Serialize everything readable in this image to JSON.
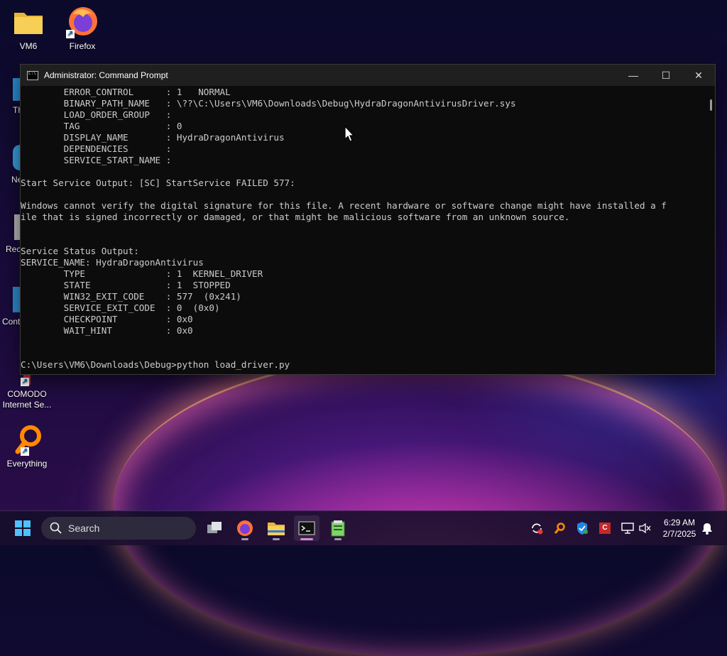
{
  "desktop": {
    "icons": [
      {
        "label": "VM6",
        "icon": "folder-icon"
      },
      {
        "label": "Firefox",
        "icon": "firefox-icon"
      },
      {
        "label": "COMODO Internet Se...",
        "icon": "comodo-icon"
      },
      {
        "label": "Everything",
        "icon": "everything-icon"
      }
    ],
    "partial_labels": [
      "Th",
      "Ne",
      "Rec",
      "Cont"
    ]
  },
  "window": {
    "title": "Administrator: Command Prompt",
    "minimize_glyph": "—",
    "maximize_glyph": "☐",
    "close_glyph": "✕"
  },
  "console": {
    "lines": [
      "        ERROR_CONTROL      : 1   NORMAL",
      "        BINARY_PATH_NAME   : \\??\\C:\\Users\\VM6\\Downloads\\Debug\\HydraDragonAntivirusDriver.sys",
      "        LOAD_ORDER_GROUP   :",
      "        TAG                : 0",
      "        DISPLAY_NAME       : HydraDragonAntivirus",
      "        DEPENDENCIES       :",
      "        SERVICE_START_NAME :",
      "",
      "Start Service Output: [SC] StartService FAILED 577:",
      "",
      "Windows cannot verify the digital signature for this file. A recent hardware or software change might have installed a f",
      "ile that is signed incorrectly or damaged, or that might be malicious software from an unknown source.",
      "",
      "",
      "Service Status Output:",
      "SERVICE_NAME: HydraDragonAntivirus",
      "        TYPE               : 1  KERNEL_DRIVER",
      "        STATE              : 1  STOPPED",
      "        WIN32_EXIT_CODE    : 577  (0x241)",
      "        SERVICE_EXIT_CODE  : 0  (0x0)",
      "        CHECKPOINT         : 0x0",
      "        WAIT_HINT          : 0x0",
      "",
      "",
      "C:\\Users\\VM6\\Downloads\\Debug>python load_driver.py"
    ]
  },
  "taskbar": {
    "search_placeholder": "Search",
    "apps": [
      "start-icon",
      "task-view-icon",
      "firefox-icon",
      "file-explorer-icon",
      "terminal-icon",
      "notepad-icon"
    ],
    "tray": [
      "sync-icon",
      "everything-tray-icon",
      "defender-icon",
      "comodo-tray-icon",
      "network-icon",
      "volume-icon"
    ],
    "time": "6:29 AM",
    "date": "2/7/2025"
  }
}
